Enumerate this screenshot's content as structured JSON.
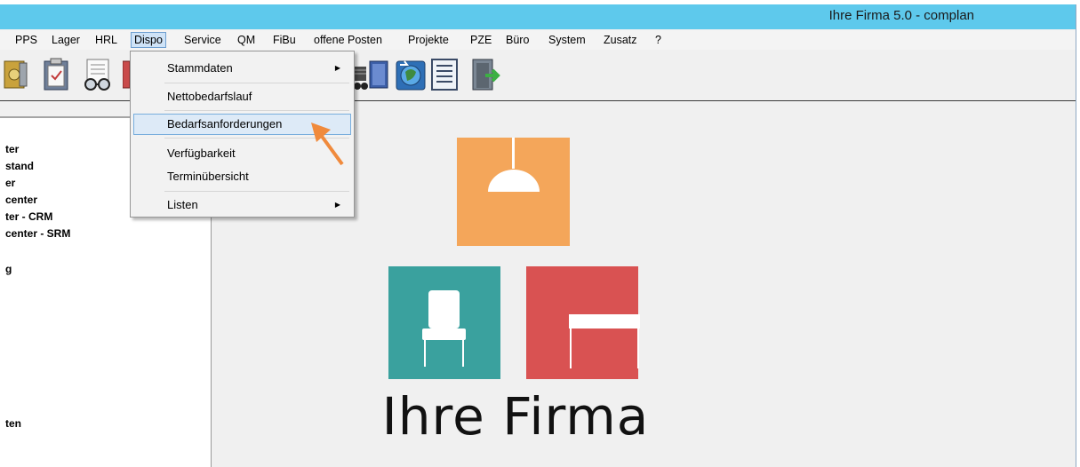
{
  "window": {
    "title": "Ihre Firma 5.0  - complan"
  },
  "menubar": {
    "items": [
      {
        "label": "PPS"
      },
      {
        "label": "Lager"
      },
      {
        "label": "HRL"
      },
      {
        "label": "Dispo"
      },
      {
        "label": "Service"
      },
      {
        "label": "QM"
      },
      {
        "label": "FiBu"
      },
      {
        "label": "offene Posten"
      },
      {
        "label": "Projekte"
      },
      {
        "label": "PZE"
      },
      {
        "label": "Büro"
      },
      {
        "label": "System"
      },
      {
        "label": "Zusatz"
      },
      {
        "label": "?"
      }
    ],
    "active": "Dispo"
  },
  "dropdown": {
    "items": [
      {
        "label": "Stammdaten",
        "submenu": true
      },
      {
        "label": "Nettobedarfslauf",
        "submenu": false
      },
      {
        "label": "Bedarfsanforderungen",
        "submenu": false,
        "highlighted": true
      },
      {
        "label": "Verfügbarkeit",
        "submenu": false
      },
      {
        "label": "Terminübersicht",
        "submenu": false
      },
      {
        "label": "Listen",
        "submenu": true
      }
    ]
  },
  "left_panel": {
    "items": [
      {
        "label": "ter"
      },
      {
        "label": "stand"
      },
      {
        "label": "er"
      },
      {
        "label": "center"
      },
      {
        "label": "ter - CRM"
      },
      {
        "label": "center - SRM"
      },
      {
        "label": "g"
      },
      {
        "label": "ten"
      }
    ]
  },
  "toolbar": {
    "icons": [
      "safe-icon",
      "clipboard-icon",
      "document-glasses-icon",
      "binoculars-icon",
      "book-icon",
      "globe-icon",
      "list-icon",
      "exit-door-icon"
    ]
  },
  "logo": {
    "text": "Ihre Firma",
    "colors": {
      "lamp_bg": "#f4a65a",
      "chair_bg": "#3aa19e",
      "table_bg": "#d95252"
    }
  },
  "colors": {
    "titlebar": "#5ec9ec",
    "highlight_arrow": "#f08a3c"
  }
}
